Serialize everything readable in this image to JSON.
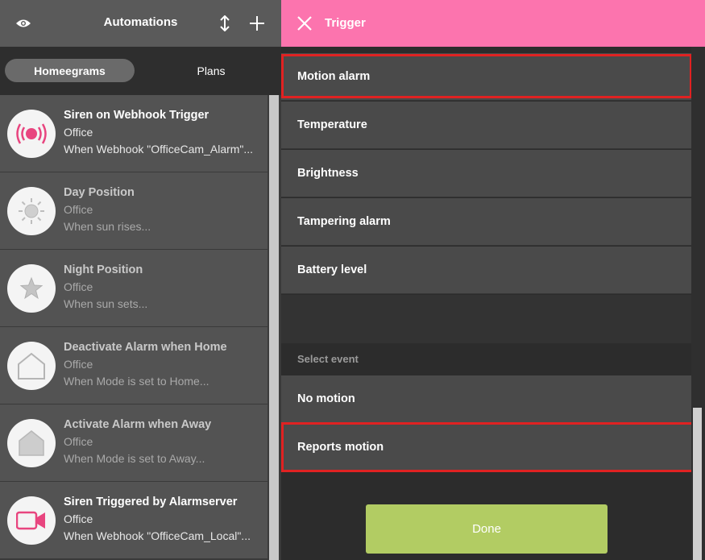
{
  "left_header": {
    "title": "Automations",
    "icons": [
      "eye-icon",
      "sort-icon",
      "plus-icon"
    ]
  },
  "segments": {
    "selected": "Homeegrams",
    "other": "Plans"
  },
  "homeegrams": [
    {
      "name": "Siren on Webhook Trigger",
      "room": "Office",
      "desc": "When Webhook \"OfficeCam_Alarm\"...",
      "icon": "siren-icon",
      "active": true
    },
    {
      "name": "Day Position",
      "room": "Office",
      "desc": "When sun rises...",
      "icon": "sun-icon",
      "active": false
    },
    {
      "name": "Night Position",
      "room": "Office",
      "desc": "When sun sets...",
      "icon": "star-icon",
      "active": false
    },
    {
      "name": "Deactivate Alarm when Home",
      "room": "Office",
      "desc": "When Mode is set to Home...",
      "icon": "house-outline-icon",
      "active": false
    },
    {
      "name": "Activate Alarm when Away",
      "room": "Office",
      "desc": "When Mode is set to Away...",
      "icon": "house-filled-icon",
      "active": false
    },
    {
      "name": "Siren Triggered by Alarmserver",
      "room": "Office",
      "desc": "When Webhook \"OfficeCam_Local\"...",
      "icon": "camera-icon",
      "active": true
    }
  ],
  "trigger": {
    "title": "Trigger",
    "attributes": [
      "Motion alarm",
      "Temperature",
      "Brightness",
      "Tampering alarm",
      "Battery level"
    ],
    "section_label": "Select event",
    "events": [
      "No motion",
      "Reports motion"
    ],
    "done_label": "Done"
  },
  "colors": {
    "accent_pink": "#fc74ae",
    "done_green": "#b2cc63",
    "highlight_red": "#e02222"
  }
}
